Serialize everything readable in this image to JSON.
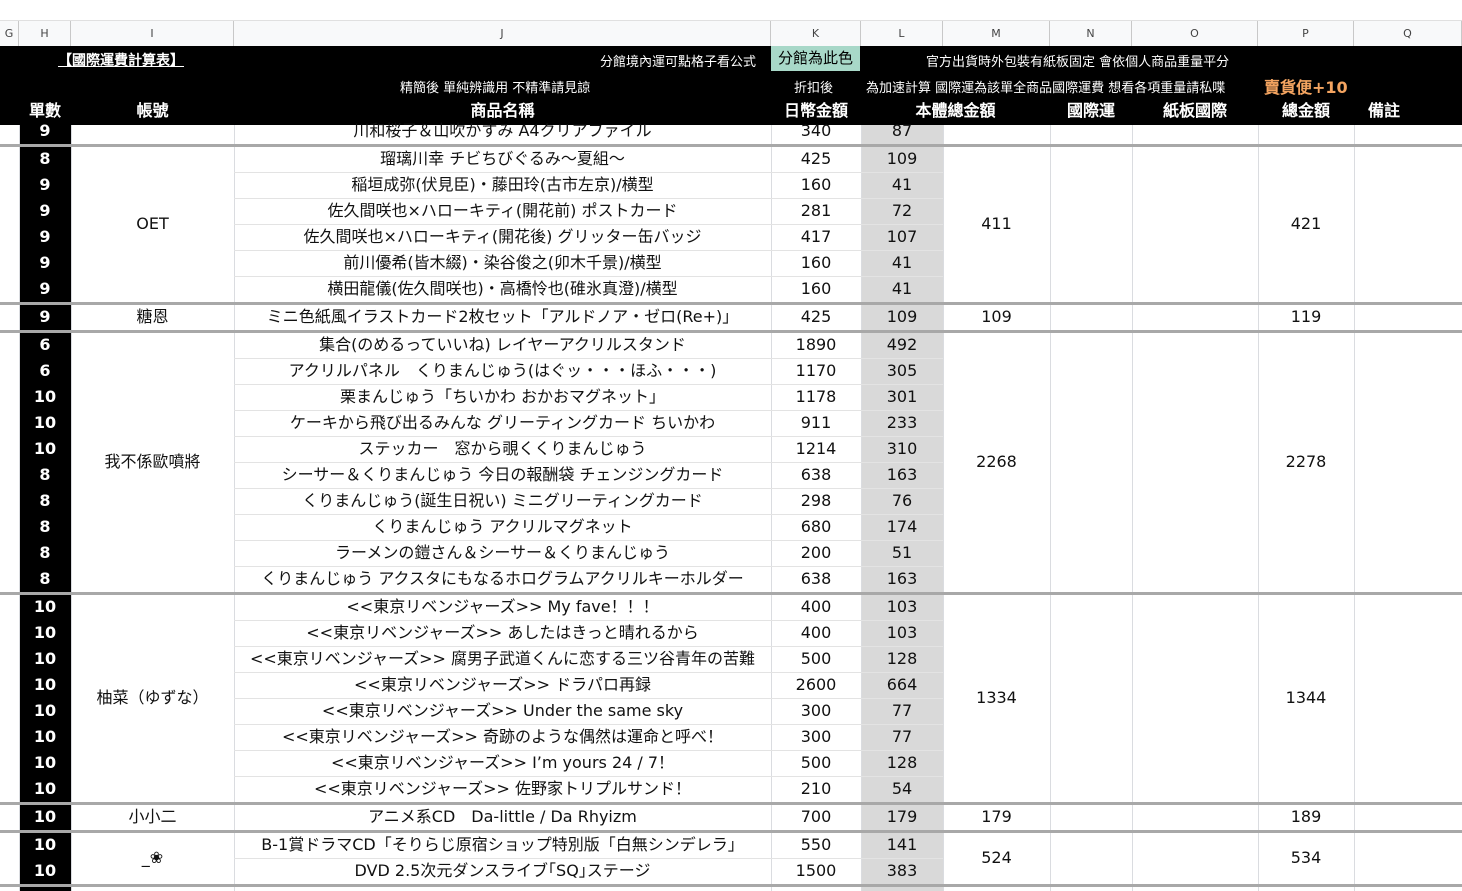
{
  "columns": [
    "H",
    "I",
    "J",
    "K",
    "L",
    "M",
    "N",
    "O",
    "P",
    "Q"
  ],
  "header": {
    "title": "【國際運費計算表】",
    "note_formula": "分館境內運可點格子看公式",
    "note_highlight": "分館為此色",
    "note_packaging": "官方出貨時外包裝有紙板固定 會依個人商品重量平分",
    "note_name": "精簡後 單純辨識用 不精準請見諒",
    "note_discount": "折扣後",
    "note_calc": "為加速計算 國際運為該單全商品國際運費 想看各項重量請私喋",
    "note_cheap": "賣貨便+10",
    "col_orders": "單數",
    "col_account": "帳號",
    "col_product": "商品名稱",
    "col_jpy": "日幣金額",
    "col_total_body": "本體總金額",
    "col_intl": "國際運",
    "col_board": "紙板國際",
    "col_total": "總金額",
    "col_remark": "備註"
  },
  "colors": {
    "header_bg": "#000000",
    "highlight": "#a8d8c8",
    "cheap": "#f4a460",
    "shade": "#d9d9d9"
  },
  "rows": [
    {
      "n": "9",
      "product": "川和桜子＆山吹かすみ A4クリアファイル",
      "jpy": "340",
      "twd": "87"
    },
    {
      "n": "8",
      "product": "瑠璃川幸 チビちびぐるみ～夏組～",
      "jpy": "425",
      "twd": "109"
    },
    {
      "n": "9",
      "product": "稲垣成弥(伏見臣)・藤田玲(古市左京)/横型",
      "jpy": "160",
      "twd": "41"
    },
    {
      "n": "9",
      "product": "佐久間咲也×ハローキティ(開花前) ポストカード",
      "jpy": "281",
      "twd": "72"
    },
    {
      "n": "9",
      "product": "佐久間咲也×ハローキティ(開花後) グリッター缶バッジ",
      "jpy": "417",
      "twd": "107"
    },
    {
      "n": "9",
      "product": "前川優希(皆木綴)・染谷俊之(卯木千景)/横型",
      "jpy": "160",
      "twd": "41"
    },
    {
      "n": "9",
      "product": "横田龍儀(佐久間咲也)・高橋怜也(碓氷真澄)/横型",
      "jpy": "160",
      "twd": "41"
    },
    {
      "n": "9",
      "product": "ミニ色紙風イラストカード2枚セット「アルドノア・ゼロ(Re+)」",
      "jpy": "425",
      "twd": "109"
    },
    {
      "n": "6",
      "product": "集合(のめるっていいね) レイヤーアクリルスタンド",
      "jpy": "1890",
      "twd": "492"
    },
    {
      "n": "6",
      "product": "アクリルパネル　くりまんじゅう(はぐッ・・・ほふ・・・)",
      "jpy": "1170",
      "twd": "305"
    },
    {
      "n": "10",
      "product": "栗まんじゅう「ちいかわ おかおマグネット」",
      "jpy": "1178",
      "twd": "301"
    },
    {
      "n": "10",
      "product": "ケーキから飛び出るみんな グリーティングカード ちいかわ",
      "jpy": "911",
      "twd": "233"
    },
    {
      "n": "10",
      "product": "ステッカー　窓から覗くくりまんじゅう",
      "jpy": "1214",
      "twd": "310"
    },
    {
      "n": "8",
      "product": "シーサー＆くりまんじゅう 今日の報酬袋 チェンジングカード",
      "jpy": "638",
      "twd": "163"
    },
    {
      "n": "8",
      "product": "くりまんじゅう(誕生日祝い) ミニグリーティングカード",
      "jpy": "298",
      "twd": "76"
    },
    {
      "n": "8",
      "product": "くりまんじゅう アクリルマグネット",
      "jpy": "680",
      "twd": "174"
    },
    {
      "n": "8",
      "product": "ラーメンの鎧さん＆シーサー＆くりまんじゅう",
      "jpy": "200",
      "twd": "51"
    },
    {
      "n": "8",
      "product": "くりまんじゅう アクスタにもなるホログラムアクリルキーホルダー",
      "jpy": "638",
      "twd": "163"
    },
    {
      "n": "10",
      "product": "<<東京リベンジャーズ>> My fave！！！",
      "jpy": "400",
      "twd": "103"
    },
    {
      "n": "10",
      "product": "<<東京リベンジャーズ>> あしたはきっと晴れるから",
      "jpy": "400",
      "twd": "103"
    },
    {
      "n": "10",
      "product": "<<東京リベンジャーズ>> 腐男子武道くんに恋する三ツ谷青年の苦難",
      "jpy": "500",
      "twd": "128"
    },
    {
      "n": "10",
      "product": "<<東京リベンジャーズ>> ドラパロ再録",
      "jpy": "2600",
      "twd": "664"
    },
    {
      "n": "10",
      "product": "<<東京リベンジャーズ>> Under the same sky",
      "jpy": "300",
      "twd": "77"
    },
    {
      "n": "10",
      "product": "<<東京リベンジャーズ>> 奇跡のような偶然は運命と呼べ！",
      "jpy": "300",
      "twd": "77"
    },
    {
      "n": "10",
      "product": "<<東京リベンジャーズ>> I’m yours 24 / 7！",
      "jpy": "500",
      "twd": "128"
    },
    {
      "n": "10",
      "product": "<<東京リベンジャーズ>> 佐野家トリプルサンド！",
      "jpy": "210",
      "twd": "54"
    },
    {
      "n": "10",
      "product": "アニメ系CD　Da-little / Da Rhyizm",
      "jpy": "700",
      "twd": "179"
    },
    {
      "n": "10",
      "product": "B-1賞ドラマCD「そりらじ原宿ショップ特別版「白無シンデレラ」",
      "jpy": "550",
      "twd": "141"
    },
    {
      "n": "10",
      "product": "DVD 2.5次元ダンスライブ｢SQ｣ステージ",
      "jpy": "1500",
      "twd": "383"
    }
  ],
  "groups": [
    {
      "account": "",
      "body_total": "",
      "total": "",
      "start": 0,
      "end": 0
    },
    {
      "account": "OET",
      "body_total": "411",
      "total": "421",
      "start": 1,
      "end": 6
    },
    {
      "account": "糖恩",
      "body_total": "109",
      "total": "119",
      "start": 7,
      "end": 7
    },
    {
      "account": "我不係歐噴將",
      "body_total": "2268",
      "total": "2278",
      "start": 8,
      "end": 17
    },
    {
      "account": "柚菜（ゆずな）",
      "body_total": "1334",
      "total": "1344",
      "start": 18,
      "end": 25
    },
    {
      "account": "小小二",
      "body_total": "179",
      "total": "189",
      "start": 26,
      "end": 26
    },
    {
      "account": "_❀",
      "body_total": "524",
      "total": "534",
      "start": 27,
      "end": 28
    }
  ]
}
